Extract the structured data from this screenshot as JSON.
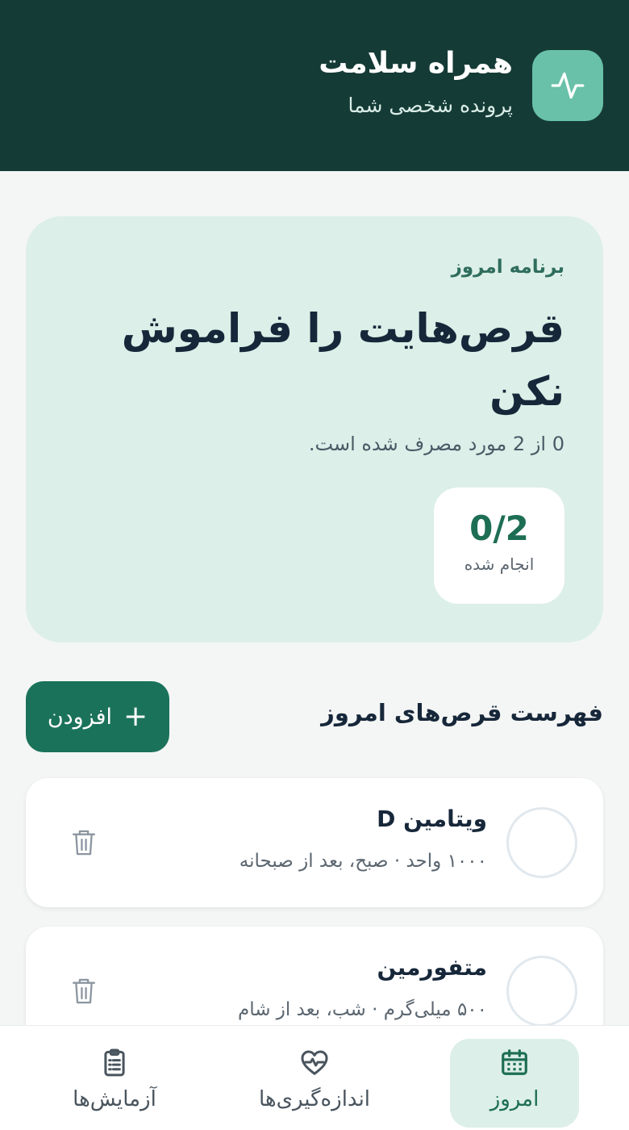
{
  "header": {
    "title": "همراه سلامت",
    "subtitle": "پرونده شخصی شما",
    "logo_icon": "heartbeat-icon"
  },
  "hero": {
    "kicker": "برنامه امروز",
    "title": "قرص‌هایت را فراموش نکن",
    "summary": "0 از 2 مورد مصرف شده است.",
    "progress_value": "0/2",
    "progress_label": "انجام شده",
    "completed": 0,
    "total": 2
  },
  "list": {
    "title": "فهرست قرص‌های امروز",
    "add_label": "افزودن",
    "add_icon": "plus-icon"
  },
  "pills": [
    {
      "name": "ویتامین D",
      "detail": "۱۰۰۰ واحد · صبح، بعد از صبحانه",
      "taken": false
    },
    {
      "name": "متفورمین",
      "detail": "۵۰۰ میلی‌گرم · شب، بعد از شام",
      "taken": false
    }
  ],
  "nav": {
    "items": [
      {
        "label": "امروز",
        "icon": "calendar-icon",
        "active": true
      },
      {
        "label": "اندازه‌گیری‌ها",
        "icon": "heart-pulse-icon",
        "active": false
      },
      {
        "label": "آزمایش‌ها",
        "icon": "clipboard-list-icon",
        "active": false
      }
    ]
  },
  "colors": {
    "header_bg": "#153b36",
    "accent": "#1b725a",
    "hero_bg": "#dcefe8",
    "logo_bg": "#68c1a8"
  }
}
